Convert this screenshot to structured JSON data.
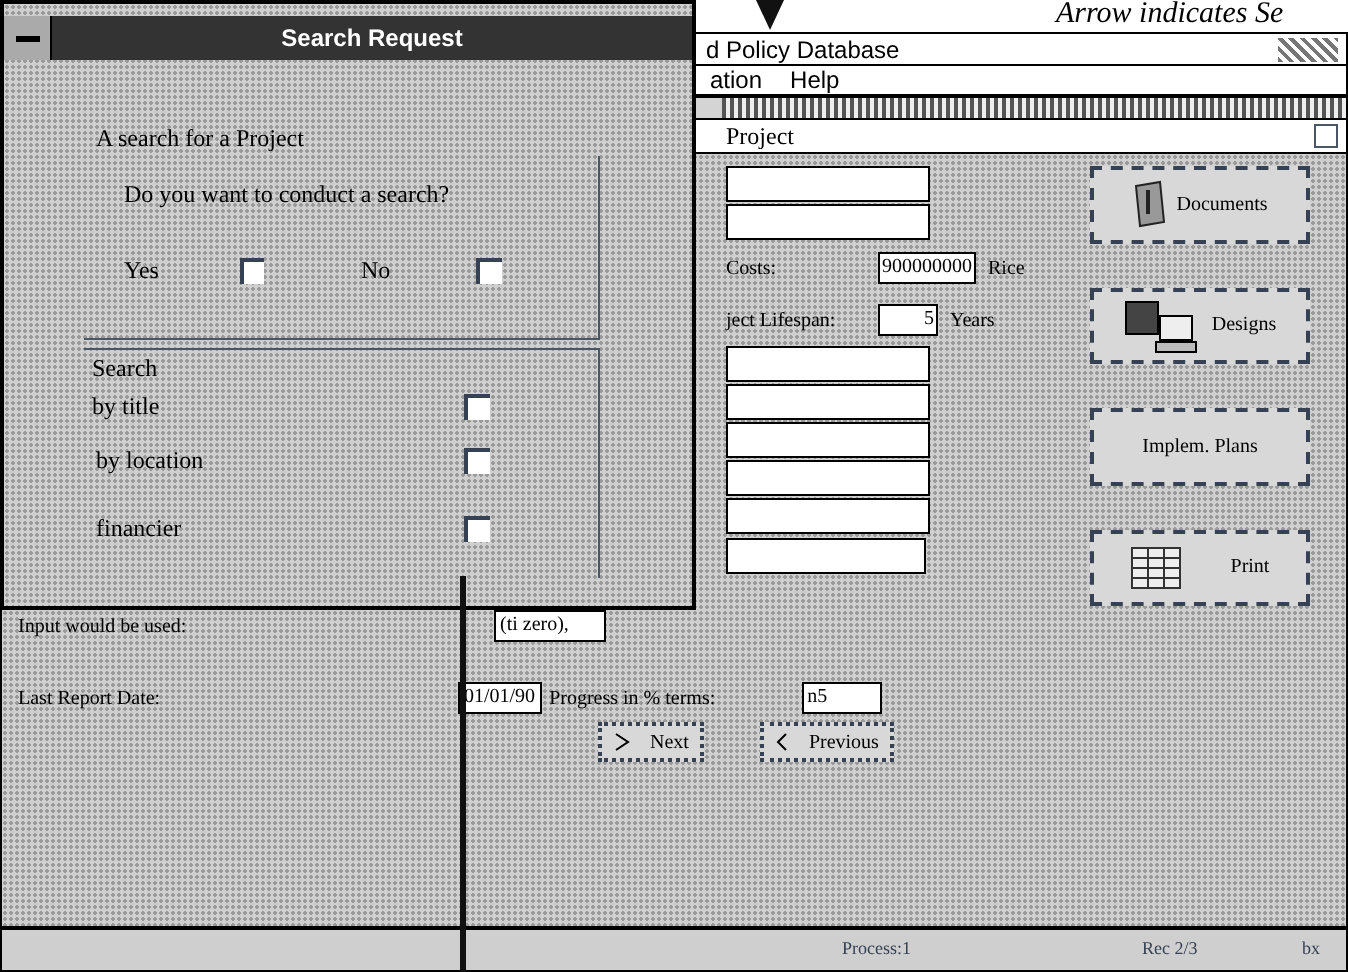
{
  "annotation": {
    "text": "Arrow indicates Se"
  },
  "window": {
    "title": "d Policy Database"
  },
  "menu": [
    "ation",
    "Help"
  ],
  "form": {
    "title": "Project",
    "fields": [
      {
        "kind": "blank"
      },
      {
        "kind": "blank"
      },
      {
        "kind": "labeled",
        "label": "Costs:",
        "value": "900000000",
        "unit": "Rice"
      },
      {
        "kind": "labeled",
        "label": "ject Lifespan:",
        "value": "5",
        "unit": "Years"
      },
      {
        "kind": "blank"
      },
      {
        "kind": "blank"
      },
      {
        "kind": "blank"
      },
      {
        "kind": "blank"
      },
      {
        "kind": "blank"
      },
      {
        "kind": "wide"
      }
    ],
    "side_buttons": [
      {
        "label": "Documents",
        "kind": "book"
      },
      {
        "label": "Designs",
        "kind": "computer"
      },
      {
        "label": "Implem. Plans",
        "kind": "text"
      },
      {
        "label": "Print",
        "kind": "table"
      }
    ],
    "usage": {
      "label": "Input would be used:",
      "value": "(ti zero),"
    },
    "report": {
      "label": "Last Report Date:",
      "date": "01/01/90",
      "progress_label": "Progress in % terms:",
      "progress": "n5"
    },
    "nav_buttons": [
      {
        "label": "Next",
        "kind": "next"
      },
      {
        "label": "Previous",
        "kind": "previous"
      }
    ]
  },
  "status_bar": [
    "Process:1",
    "Rec 2/3",
    "bx"
  ],
  "dialog": {
    "title": "Search Request",
    "heading": "A search for a Project",
    "question": "Do you want to conduct a search?",
    "choices": [
      {
        "label": "Yes",
        "checked": false
      },
      {
        "label": "No",
        "checked": false
      }
    ],
    "group": "Search",
    "options": [
      {
        "label": "by title",
        "checked": false
      },
      {
        "label": "by location",
        "checked": false
      },
      {
        "label": "financier",
        "checked": false
      }
    ]
  }
}
